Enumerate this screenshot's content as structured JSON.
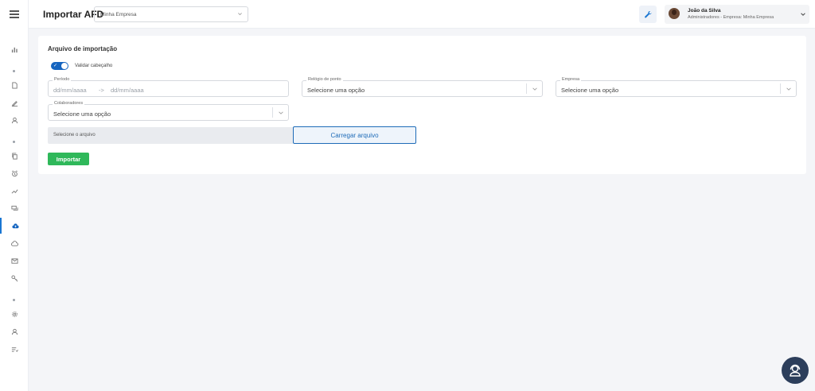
{
  "sidebar": {
    "icons": [
      "bar-chart-icon",
      "document-icon",
      "pen-icon",
      "user-icon",
      "copy-icon",
      "alarm-icon",
      "trend-icon",
      "chat-icon",
      "cloud-upload-icon",
      "cloud-icon",
      "mail-icon",
      "key-icon",
      "gear-icon",
      "person-icon",
      "list-icon"
    ],
    "active": "cloud-upload-icon"
  },
  "header": {
    "title": "Importar AFD",
    "company_select": "Minha Empresa",
    "tool_icon": "wrench-icon",
    "user": {
      "name": "João da Silva",
      "role": "Administradores - Empresa: Minha Empresa"
    }
  },
  "card": {
    "title": "Arquivo de importação",
    "toggle_label": "Validar cabeçalho",
    "toggle_on": true,
    "periodo": {
      "label": "Período",
      "start_placeholder": "dd/mm/aaaa",
      "arrow": "->",
      "end_placeholder": "dd/mm/aaaa"
    },
    "relogio": {
      "label": "Relógio de ponto",
      "value": "Selecione uma opção"
    },
    "empresa": {
      "label": "Empresa",
      "value": "Selecione uma opção"
    },
    "colaboradores": {
      "label": "Colaboradores",
      "value": "Selecione uma opção"
    },
    "file_placeholder": "Selecione o arquivo",
    "upload_label": "Carregar arquivo",
    "import_label": "Importar"
  },
  "colors": {
    "accent": "#1565c0",
    "success": "#2fb85a",
    "fab": "#2c3e5b"
  }
}
